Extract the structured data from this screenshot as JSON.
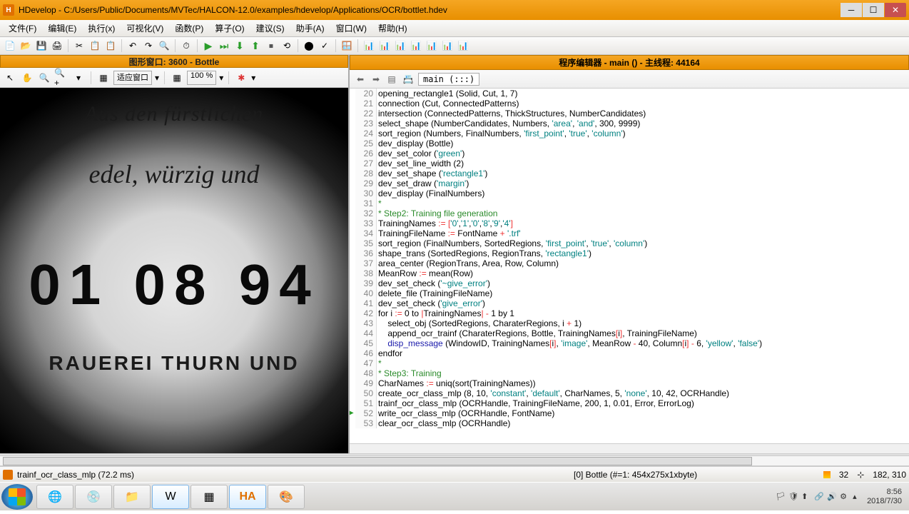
{
  "window": {
    "title": "HDevelop - C:/Users/Public/Documents/MVTec/HALCON-12.0/examples/hdevelop/Applications/OCR/bottlet.hdev"
  },
  "menu": {
    "items": [
      "文件(F)",
      "编辑(E)",
      "执行(x)",
      "可视化(V)",
      "函数(P)",
      "算子(O)",
      "建议(S)",
      "助手(A)",
      "窗口(W)",
      "帮助(H)"
    ]
  },
  "graphics": {
    "title": "图形窗口: 3600 - Bottle",
    "fit_label": "适应窗口",
    "zoom": "100 %",
    "bottle_line1": "Aus den fürstlichen",
    "bottle_line2": "edel, würzig und",
    "bottle_date": "01 08 94",
    "bottle_line3": "RAUEREI THURN UND"
  },
  "editor": {
    "title": "程序编辑器 - main () - 主线程: 44164",
    "proc": "main (:::)"
  },
  "code": [
    {
      "n": 20,
      "t": "opening_rectangle1 (Solid, Cut, 1, 7)"
    },
    {
      "n": 21,
      "t": "connection (Cut, ConnectedPatterns)"
    },
    {
      "n": 22,
      "t": "intersection (ConnectedPatterns, ThickStructures, NumberCandidates)"
    },
    {
      "n": 23,
      "t": "select_shape (NumberCandidates, Numbers, 'area', 'and', 300, 9999)"
    },
    {
      "n": 24,
      "t": "sort_region (Numbers, FinalNumbers, 'first_point', 'true', 'column')"
    },
    {
      "n": 25,
      "t": "dev_display (Bottle)"
    },
    {
      "n": 26,
      "t": "dev_set_color ('green')"
    },
    {
      "n": 27,
      "t": "dev_set_line_width (2)"
    },
    {
      "n": 28,
      "t": "dev_set_shape ('rectangle1')"
    },
    {
      "n": 29,
      "t": "dev_set_draw ('margin')"
    },
    {
      "n": 30,
      "t": "dev_display (FinalNumbers)"
    },
    {
      "n": 31,
      "t": "*"
    },
    {
      "n": 32,
      "t": "* Step2: Training file generation"
    },
    {
      "n": 33,
      "t": "TrainingNames := ['0','1','0','8','9','4']"
    },
    {
      "n": 34,
      "t": "TrainingFileName := FontName + '.trf'"
    },
    {
      "n": 35,
      "t": "sort_region (FinalNumbers, SortedRegions, 'first_point', 'true', 'column')"
    },
    {
      "n": 36,
      "t": "shape_trans (SortedRegions, RegionTrans, 'rectangle1')"
    },
    {
      "n": 37,
      "t": "area_center (RegionTrans, Area, Row, Column)"
    },
    {
      "n": 38,
      "t": "MeanRow := mean(Row)"
    },
    {
      "n": 39,
      "t": "dev_set_check ('~give_error')"
    },
    {
      "n": 40,
      "t": "delete_file (TrainingFileName)"
    },
    {
      "n": 41,
      "t": "dev_set_check ('give_error')"
    },
    {
      "n": 42,
      "t": "for i := 0 to |TrainingNames| - 1 by 1"
    },
    {
      "n": 43,
      "t": "    select_obj (SortedRegions, CharaterRegions, i + 1)"
    },
    {
      "n": 44,
      "t": "    append_ocr_trainf (CharaterRegions, Bottle, TrainingNames[i], TrainingFileName)"
    },
    {
      "n": 45,
      "t": "    disp_message (WindowID, TrainingNames[i], 'image', MeanRow - 40, Column[i] - 6, 'yellow', 'false')"
    },
    {
      "n": 46,
      "t": "endfor"
    },
    {
      "n": 47,
      "t": "*"
    },
    {
      "n": 48,
      "t": "* Step3: Training"
    },
    {
      "n": 49,
      "t": "CharNames := uniq(sort(TrainingNames))"
    },
    {
      "n": 50,
      "t": "create_ocr_class_mlp (8, 10, 'constant', 'default', CharNames, 5, 'none', 10, 42, OCRHandle)"
    },
    {
      "n": 51,
      "t": "trainf_ocr_class_mlp (OCRHandle, TrainingFileName, 200, 1, 0.01, Error, ErrorLog)"
    },
    {
      "n": 52,
      "t": "write_ocr_class_mlp (OCRHandle, FontName)",
      "pc": true
    },
    {
      "n": 53,
      "t": "clear_ocr_class_mlp (OCRHandle)"
    }
  ],
  "status": {
    "left": "trainf_ocr_class_mlp (72.2 ms)",
    "mid": "[0] Bottle (#=1: 454x275x1xbyte)",
    "pages": "32",
    "coords": "182, 310"
  },
  "clock": {
    "time": "8:56",
    "date": "2018/7/30"
  },
  "colors": {
    "accent": "#e88f00",
    "comment": "#2a8a2a",
    "string": "#008080",
    "call": "#1818aa"
  }
}
